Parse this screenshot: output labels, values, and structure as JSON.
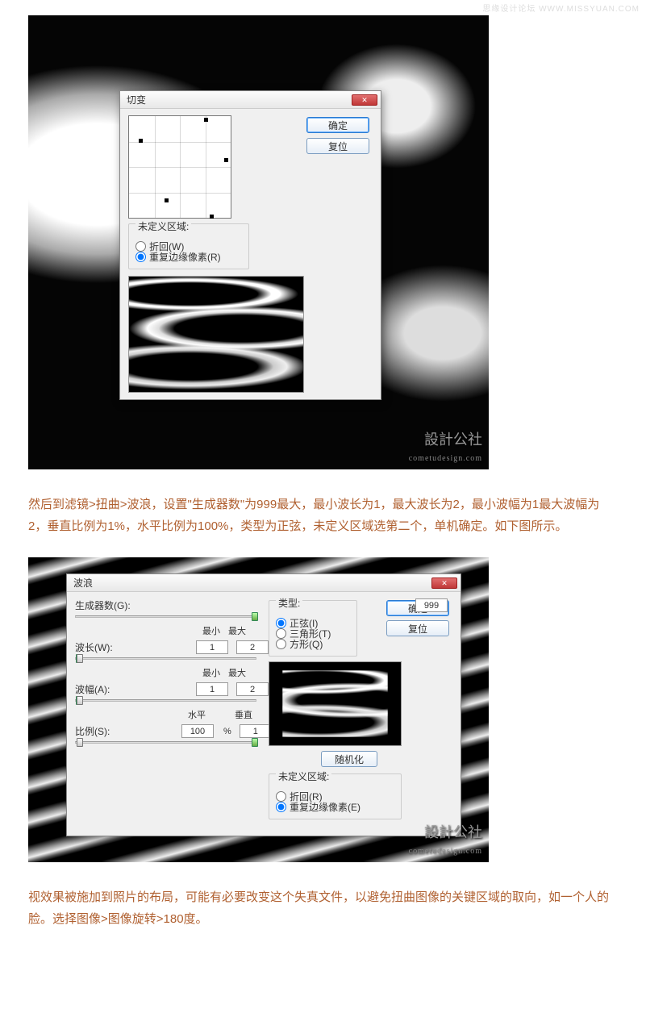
{
  "watermark_top": "思缘设计论坛  WWW.MISSYUAN.COM",
  "paragraph1": "然后到滤镜>扭曲>波浪，设置\"生成器数\"为999最大，最小波长为1，最大波长为2，最小波幅为1最大波幅为2，垂直比例为1%，水平比例为100%，类型为正弦，未定义区域选第二个，单机确定。如下图所示。",
  "paragraph2": "视效果被施加到照片的布局，可能有必要改变这个失真文件，以避免扭曲图像的关键区域的取向，如一个人的脸。选择图像>图像旋转>180度。",
  "big_watermark": "設計公社",
  "big_watermark_sub": "cometudesign.com",
  "shear_dialog": {
    "title": "切变",
    "ok": "确定",
    "reset": "复位",
    "undefined_area_label": "未定义区域:",
    "wrap_around": "折回(W)",
    "repeat_edge": "重复边缘像素(R)"
  },
  "wave_dialog": {
    "title": "波浪",
    "ok": "确定",
    "reset": "复位",
    "generators_label": "生成器数(G):",
    "generators_value": "999",
    "min_label": "最小",
    "max_label": "最大",
    "wavelength_label": "波长(W):",
    "wavelength_min": "1",
    "wavelength_max": "2",
    "amplitude_label": "波幅(A):",
    "amplitude_min": "1",
    "amplitude_max": "2",
    "horiz_label": "水平",
    "vert_label": "垂直",
    "scale_label": "比例(S):",
    "scale_horiz": "100",
    "scale_vert": "1",
    "percent": "%",
    "type_label": "类型:",
    "type_sine": "正弦(I)",
    "type_triangle": "三角形(T)",
    "type_square": "方形(Q)",
    "randomize": "随机化",
    "undefined_area_label": "未定义区域:",
    "wrap_around": "折回(R)",
    "repeat_edge": "重复边缘像素(E)"
  }
}
